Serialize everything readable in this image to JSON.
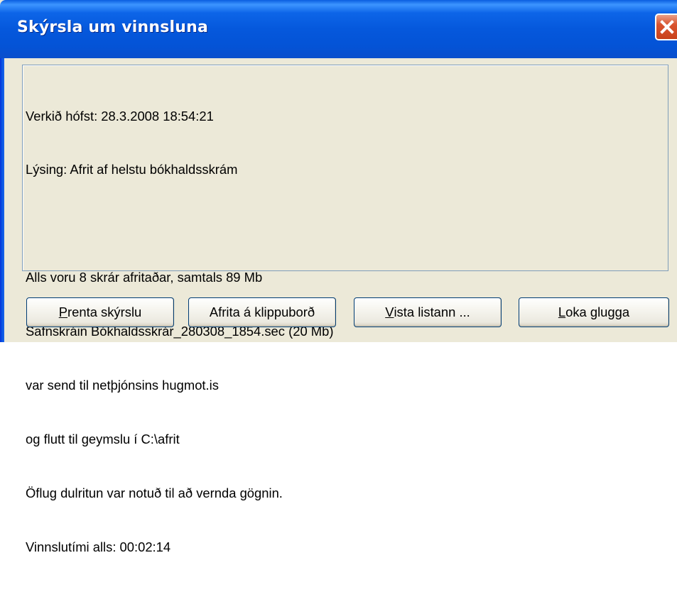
{
  "window": {
    "title": "Skýrsla um vinnsluna",
    "close_label": "×"
  },
  "report": {
    "lines": [
      "Verkið hófst: 28.3.2008 18:54:21",
      "Lýsing: Afrit af helstu bókhaldsskrám",
      "",
      "Alls voru 8 skrár afritaðar, samtals 89 Mb",
      "Safnskráin Bókhaldsskrár_280308_1854.sec (20 Mb)",
      "var send til netþjónsins hugmot.is",
      "og flutt til geymslu í C:\\afrit",
      "Öflug dulritun var notuð til að vernda gögnin.",
      "Vinnslutími alls: 00:02:14"
    ]
  },
  "buttons": {
    "print": {
      "accel": "P",
      "rest": "renta skýrslu"
    },
    "copy": {
      "label": "Afrita á klippuborð"
    },
    "save": {
      "accel": "V",
      "rest": "ista listann ..."
    },
    "close": {
      "accel": "L",
      "rest": "oka glugga"
    }
  },
  "icons": {
    "close": "close-x-icon"
  },
  "colors": {
    "titlebar": "#0558dc",
    "close_button": "#d9542f",
    "dialog_background": "#ece9d8",
    "button_border": "#003c74"
  }
}
